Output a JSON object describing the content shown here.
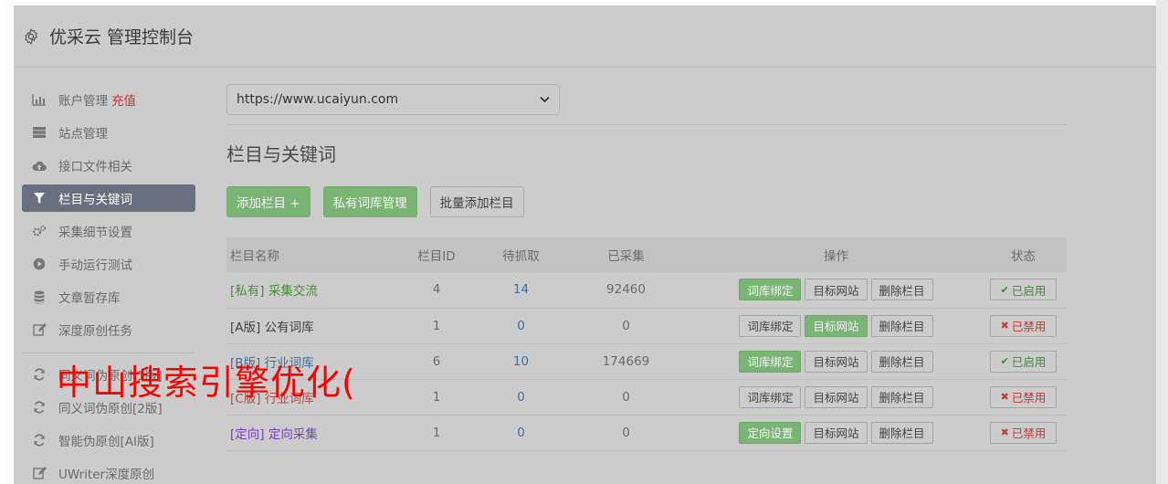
{
  "header": {
    "title": "优采云 管理控制台",
    "icon": "gear-icon"
  },
  "sidebar": {
    "items": [
      {
        "label": "账户管理",
        "extra": "充值",
        "icon": "bar-chart-icon"
      },
      {
        "label": "站点管理",
        "icon": "server-icon"
      },
      {
        "label": "接口文件相关",
        "icon": "cloud-upload-icon"
      },
      {
        "label": "栏目与关键词",
        "icon": "filter-icon",
        "active": true
      },
      {
        "label": "采集细节设置",
        "icon": "cogs-icon"
      },
      {
        "label": "手动运行测试",
        "icon": "play-circle-icon"
      },
      {
        "label": "文章暂存库",
        "icon": "database-icon"
      },
      {
        "label": "深度原创任务",
        "icon": "edit-icon"
      }
    ],
    "items2": [
      {
        "label": "同义词伪原创[1版]",
        "icon": "refresh-icon"
      },
      {
        "label": "同义词伪原创[2版]",
        "icon": "refresh-icon"
      },
      {
        "label": "智能伪原创[AI版]",
        "icon": "refresh-icon"
      },
      {
        "label": "UWriter深度原创",
        "icon": "edit-icon"
      }
    ]
  },
  "main": {
    "site_select": "https://www.ucaiyun.com",
    "section_title": "栏目与关键词",
    "buttons": {
      "add_column": "添加栏目 +",
      "private_lib": "私有词库管理",
      "batch_add": "批量添加栏目"
    },
    "table": {
      "headers": [
        "栏目名称",
        "栏目ID",
        "待抓取",
        "已采集",
        "操作",
        "状态"
      ],
      "rows": [
        {
          "tag": "[私有]",
          "name": "采集交流",
          "id": "4",
          "pending": "14",
          "collected": "92460",
          "op1": "词库绑定",
          "op2": "目标网站",
          "op3": "删除栏目",
          "status": "已启用"
        },
        {
          "tag": "[A版]",
          "name": "公有词库",
          "id": "1",
          "pending": "0",
          "collected": "0",
          "op1": "词库绑定",
          "op2": "目标网站",
          "op3": "删除栏目",
          "status": "已禁用"
        },
        {
          "tag": "[B版]",
          "name": "行业词库",
          "id": "6",
          "pending": "10",
          "collected": "174669",
          "op1": "词库绑定",
          "op2": "目标网站",
          "op3": "删除栏目",
          "status": "已启用"
        },
        {
          "tag": "[C版]",
          "name": "行业词库",
          "id": "1",
          "pending": "0",
          "collected": "0",
          "op1": "词库绑定",
          "op2": "目标网站",
          "op3": "删除栏目",
          "status": "已禁用"
        },
        {
          "tag": "[定向]",
          "name": "定向采集",
          "id": "1",
          "pending": "0",
          "collected": "0",
          "op1": "定向设置",
          "op2": "目标网站",
          "op3": "删除栏目",
          "status": "已禁用"
        }
      ]
    }
  },
  "overlay_text": "中山搜索引擎优化(",
  "colors": {
    "active_nav": "#68707d",
    "green_button": "#7bb575",
    "recharge": "#d0302a",
    "overlay": "#ff0000"
  }
}
